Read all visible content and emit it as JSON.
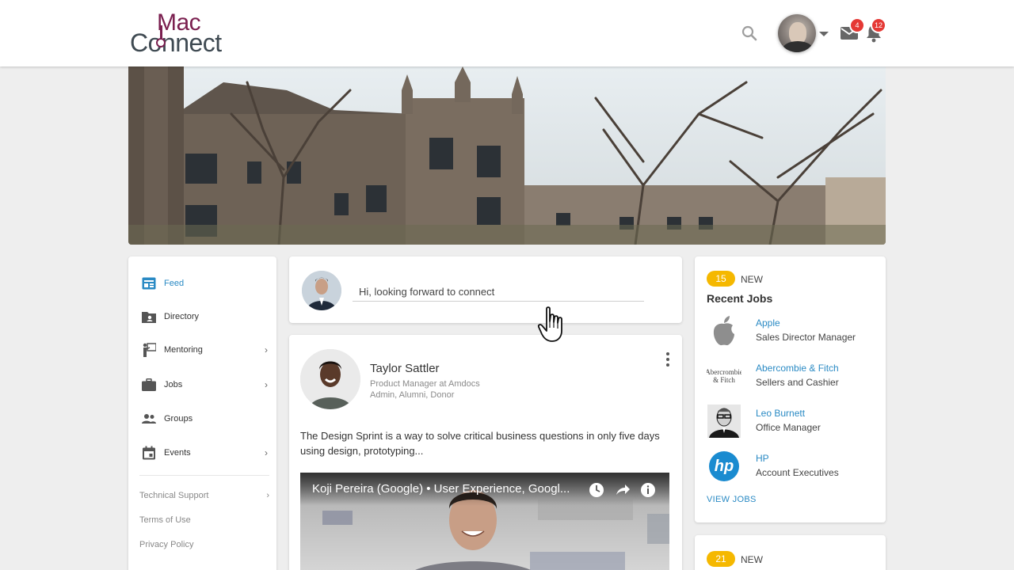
{
  "brand": {
    "line1": "Mac",
    "line2": "Connect",
    "color_primary": "#7a1f4f",
    "color_secondary": "#3f4a52"
  },
  "header": {
    "search_icon": "search-icon",
    "messages_count": "4",
    "notifications_count": "12"
  },
  "sidebar": {
    "items": [
      {
        "label": "Feed",
        "icon": "feed-icon",
        "active": true,
        "chevron": ""
      },
      {
        "label": "Directory",
        "icon": "directory-icon",
        "chevron": ""
      },
      {
        "label": "Mentoring",
        "icon": "mentoring-icon",
        "chevron": "›"
      },
      {
        "label": "Jobs",
        "icon": "briefcase-icon",
        "chevron": "›"
      },
      {
        "label": "Groups",
        "icon": "groups-icon",
        "chevron": ""
      },
      {
        "label": "Events",
        "icon": "calendar-icon",
        "chevron": "›"
      }
    ],
    "footer": [
      {
        "label": "Technical Support",
        "chevron": "›"
      },
      {
        "label": "Terms of Use",
        "chevron": ""
      },
      {
        "label": "Privacy Policy",
        "chevron": ""
      }
    ]
  },
  "composer": {
    "value": "Hi, looking forward to connect"
  },
  "post": {
    "author": "Taylor Sattler",
    "role": "Product Manager at Amdocs",
    "tags": "Admin, Alumni, Donor",
    "text": "The Design Sprint is a way to solve critical business questions in only five days using design, prototyping...",
    "video_title": "Koji Pereira (Google) • User Experience, Googl..."
  },
  "jobs": {
    "new_count": "15",
    "new_label": "NEW",
    "heading": "Recent Jobs",
    "items": [
      {
        "company": "Apple",
        "title": "Sales Director Manager",
        "logo": "apple-logo-icon"
      },
      {
        "company": "Abercombie & Fitch",
        "title": "Sellers and Cashier",
        "logo": "abercrombie-logo",
        "logo_text": "Abercrombie & Fitch"
      },
      {
        "company": "Leo Burnett",
        "title": "Office Manager",
        "logo": "leo-burnett-logo"
      },
      {
        "company": "HP",
        "title": "Account Executives",
        "logo": "hp-logo",
        "logo_text": "hp"
      }
    ],
    "view_all": "VIEW JOBS"
  },
  "jobs2": {
    "new_count": "21",
    "new_label": "NEW"
  },
  "colors": {
    "accent": "#2a8ac4",
    "badge": "#e53935",
    "pill": "#f5b800"
  }
}
